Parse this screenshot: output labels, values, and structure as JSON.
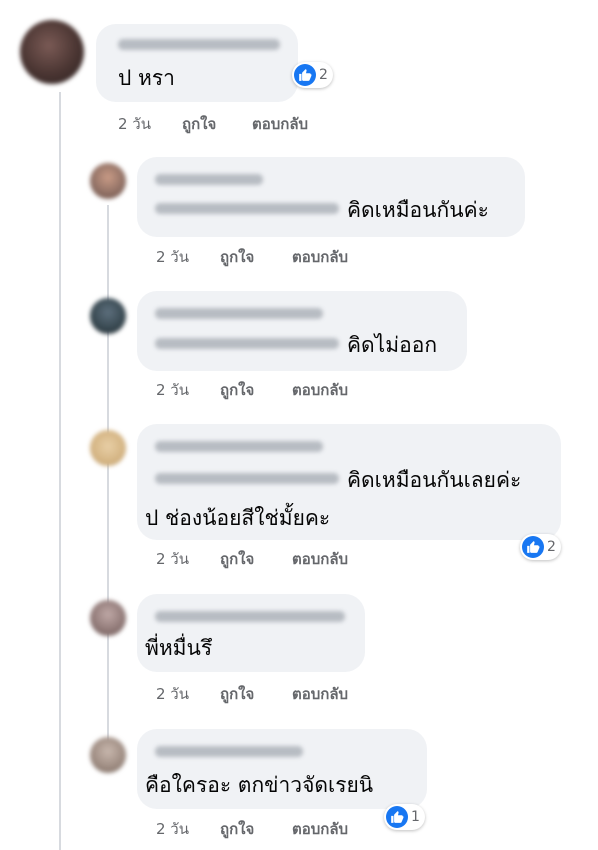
{
  "colors": {
    "bubble": "#f0f2f5",
    "like_blue": "#1877f2",
    "meta_text": "#65676b"
  },
  "main_comment": {
    "author_name": "Wijittar Sukkaew",
    "text": "ป หรา",
    "reaction_count": "2",
    "reaction_icon": "like-icon",
    "age": "2 วัน",
    "like_label": "ถูกใจ",
    "reply_label": "ตอบกลับ"
  },
  "replies": [
    {
      "author_name": "Chada Ingta",
      "tag": "Wijittar Sukkaew",
      "text": "คิดเหมือนกันค่ะ",
      "age": "2 วัน",
      "like_label": "ถูกใจ",
      "reply_label": "ตอบกลับ"
    },
    {
      "author_name": "Tanyong Laksongda",
      "tag": "Wijittar Sukkaew",
      "text": "คิดไม่ออก",
      "age": "2 วัน",
      "like_label": "ถูกใจ",
      "reply_label": "ตอบกลับ"
    },
    {
      "author_name": "Seda Sing Chaosi",
      "tag": "Wijittar Sukkaew",
      "text": "คิดเหมือนกันเลยค่ะ",
      "text_line2": "ป ช่องน้อยสีใช่มั้ยคะ",
      "reaction_count": "2",
      "reaction_icon": "like-icon",
      "age": "2 วัน",
      "like_label": "ถูกใจ",
      "reply_label": "ตอบกลับ"
    },
    {
      "author_name": "Lakkana Thiangsan",
      "text": "พี่หมื่นรึ",
      "age": "2 วัน",
      "like_label": "ถูกใจ",
      "reply_label": "ตอบกลับ"
    },
    {
      "author_name": "ส่านนีย์ริน ดดา",
      "text": "คือใครอะ ตกข่าวจัดเรยนิ",
      "reaction_count": "1",
      "reaction_icon": "like-icon",
      "age": "2 วัน",
      "like_label": "ถูกใจ",
      "reply_label": "ตอบกลับ"
    }
  ]
}
